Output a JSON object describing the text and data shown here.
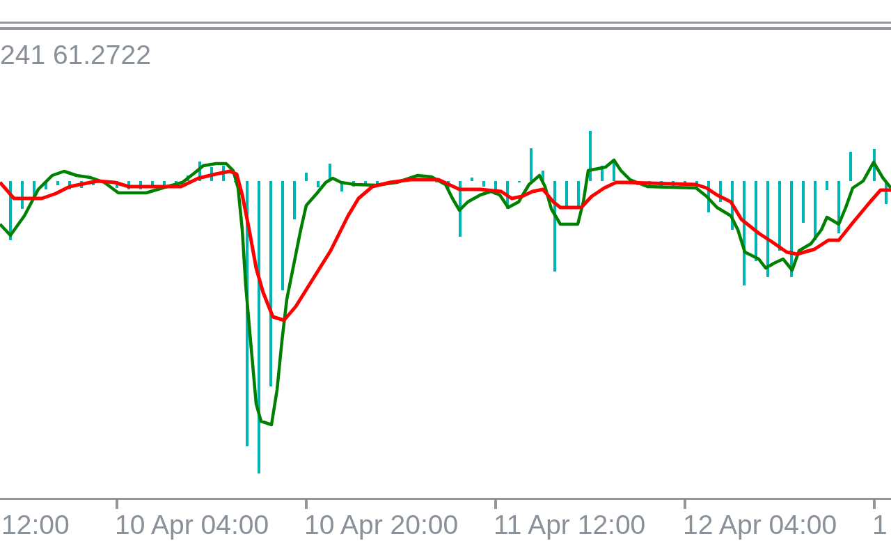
{
  "indicator": {
    "values_label": "241 61.2722"
  },
  "time_axis": {
    "labels": [
      "12:00",
      "10 Apr 04:00",
      "10 Apr 20:00",
      "11 Apr 12:00",
      "12 Apr 04:00",
      "1"
    ]
  }
}
